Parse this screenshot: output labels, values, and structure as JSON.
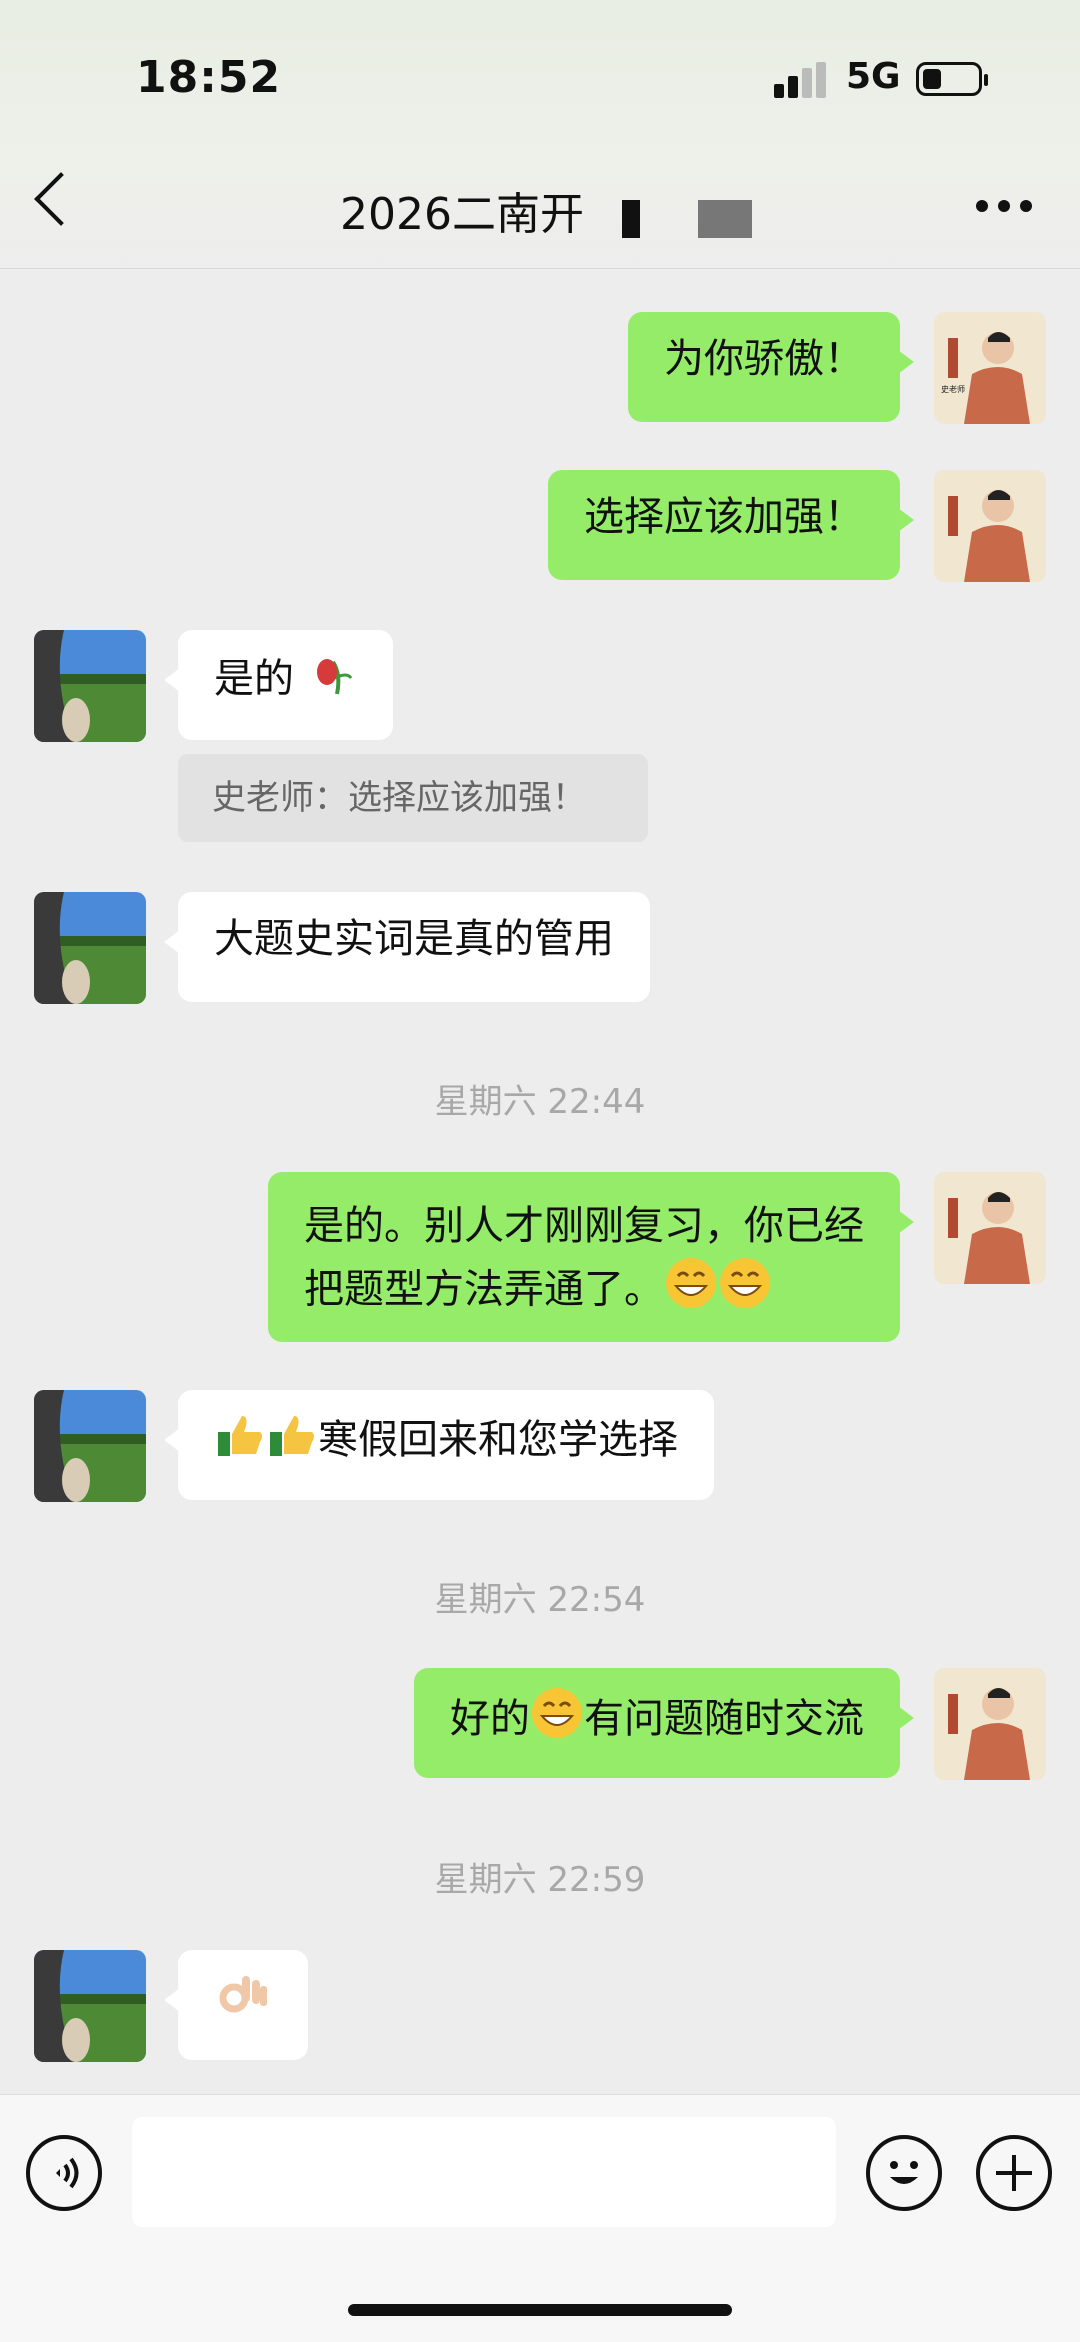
{
  "status_bar": {
    "time": "18:52",
    "network": "5G"
  },
  "header": {
    "title": "2026二南开"
  },
  "messages": [
    {
      "from": "me",
      "text": "为你骄傲！"
    },
    {
      "from": "me",
      "text": "选择应该加强！"
    },
    {
      "from": "other",
      "text": "是的"
    },
    {
      "quote": "史老师：选择应该加强！"
    },
    {
      "from": "other",
      "text": "大题史实词是真的管用"
    },
    {
      "timestamp": "星期六 22:44"
    },
    {
      "from": "me",
      "line1": "是的。别人才刚刚复习，你已经",
      "line2": "把题型方法弄通了。"
    },
    {
      "from": "other",
      "text": "寒假回来和您学选择"
    },
    {
      "timestamp": "星期六 22:54"
    },
    {
      "from": "me",
      "text_before": "好的",
      "text_after": "有问题随时交流"
    },
    {
      "timestamp": "星期六 22:59"
    },
    {
      "from": "other",
      "text": ""
    }
  ],
  "avatar_me_label": "史老师",
  "icons": {
    "back": "chevron-left-icon",
    "more": "more-dots-icon",
    "voice": "voice-icon",
    "emoji": "emoji-icon",
    "plus": "plus-icon"
  },
  "colors": {
    "my_bubble": "#95ec69",
    "other_bubble": "#ffffff",
    "background": "#ededed"
  }
}
